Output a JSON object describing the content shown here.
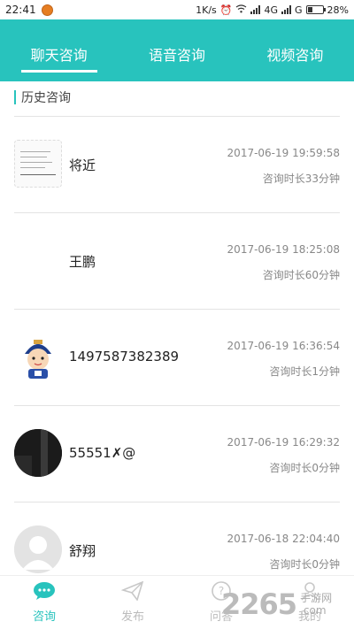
{
  "status_bar": {
    "time": "22:41",
    "net_speed": "1K/s",
    "network1": "4G",
    "network2": "G",
    "battery": "28%"
  },
  "tabs": [
    {
      "label": "聊天咨询",
      "active": true
    },
    {
      "label": "语音咨询",
      "active": false
    },
    {
      "label": "视频咨询",
      "active": false
    }
  ],
  "section": {
    "title": "历史咨询"
  },
  "consultations": [
    {
      "name": "将近",
      "time": "2017-06-19 19:59:58",
      "duration": "咨询时长33分钟",
      "avatar": "document-thumbnail"
    },
    {
      "name": "王鹏",
      "time": "2017-06-19 18:25:08",
      "duration": "咨询时长60分钟",
      "avatar": "blank"
    },
    {
      "name": "1497587382389",
      "time": "2017-06-19 16:36:54",
      "duration": "咨询时长1分钟",
      "avatar": "cartoon-character"
    },
    {
      "name": "55551✗@",
      "time": "2017-06-19 16:29:32",
      "duration": "咨询时长0分钟",
      "avatar": "dark-photo"
    },
    {
      "name": "舒翔",
      "time": "2017-06-18 22:04:40",
      "duration": "咨询时长0分钟",
      "avatar": "default-user"
    }
  ],
  "bottom_nav": [
    {
      "label": "咨询",
      "icon": "chat-bubble-icon",
      "active": true
    },
    {
      "label": "发布",
      "icon": "paper-plane-icon",
      "active": false
    },
    {
      "label": "问答",
      "icon": "question-icon",
      "active": false
    },
    {
      "label": "我的",
      "icon": "person-icon",
      "active": false
    }
  ],
  "watermark": {
    "number": "2265",
    "line1": "手游网",
    "line2": ".com"
  },
  "colors": {
    "accent": "#28c3bd",
    "muted": "#888888"
  }
}
